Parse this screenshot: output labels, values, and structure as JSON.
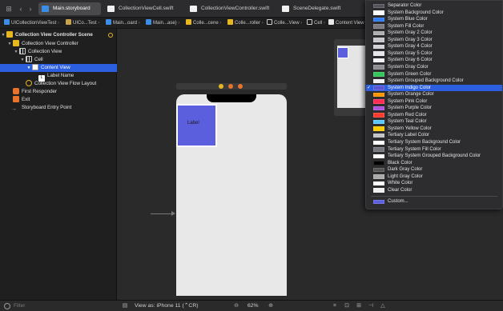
{
  "tabs": [
    {
      "label": "Main.storyboard",
      "kind": "sb",
      "active": true
    },
    {
      "label": "CollectionViewCell.swift",
      "kind": "sw",
      "active": false
    },
    {
      "label": "CollectionViewController.swift",
      "kind": "sw",
      "active": false
    },
    {
      "label": "SceneDelegate.swift",
      "kind": "sw",
      "active": false
    }
  ],
  "breadcrumbs": [
    "UICollectionViewTest",
    "UICo...Test",
    "Main...oard",
    "Main...ase)",
    "Colle...cene",
    "Colle...roller",
    "Colle...View",
    "Cell",
    "Content View"
  ],
  "outline": [
    {
      "label": "Collection View Controller Scene",
      "bold": true
    },
    {
      "label": "Collection View Controller"
    },
    {
      "label": "Collection View"
    },
    {
      "label": "Cell"
    },
    {
      "label": "Content View"
    },
    {
      "label": "Label Name"
    },
    {
      "label": "Collection View Flow Layout"
    },
    {
      "label": "First Responder"
    },
    {
      "label": "Exit"
    },
    {
      "label": "Storyboard Entry Point"
    }
  ],
  "filter_placeholder": "Filter",
  "canvas": {
    "cell_label": "Label"
  },
  "bottom": {
    "view_as": "View as: iPhone 11 (",
    "view_as_key": "⌃C",
    "view_as_tail": "R)",
    "zoom": "62%"
  },
  "menu_items": [
    {
      "label": "Separator Color",
      "color": "#54545a"
    },
    {
      "label": "System Background Color",
      "color": "#ffffff"
    },
    {
      "label": "System Blue Color",
      "color": "#2f7cf6"
    },
    {
      "label": "System Fill Color",
      "color": "#7a7a80"
    },
    {
      "label": "System Gray 2 Color",
      "color": "#aeaeb2"
    },
    {
      "label": "System Gray 3 Color",
      "color": "#c7c7cc"
    },
    {
      "label": "System Gray 4 Color",
      "color": "#d1d1d6"
    },
    {
      "label": "System Gray 5 Color",
      "color": "#e5e5ea"
    },
    {
      "label": "System Gray 6 Color",
      "color": "#f2f2f7"
    },
    {
      "label": "System Gray Color",
      "color": "#8e8e93"
    },
    {
      "label": "System Green Color",
      "color": "#34c759"
    },
    {
      "label": "System Grouped Background Color",
      "color": "#f2f2f7"
    },
    {
      "label": "System Indigo Color",
      "color": "#5856d6",
      "selected": true
    },
    {
      "label": "System Orange Color",
      "color": "#ff9500"
    },
    {
      "label": "System Pink Color",
      "color": "#ff2d55"
    },
    {
      "label": "System Purple Color",
      "color": "#af52de"
    },
    {
      "label": "System Red Color",
      "color": "#ff3b30"
    },
    {
      "label": "System Teal Color",
      "color": "#5ac8fa"
    },
    {
      "label": "System Yellow Color",
      "color": "#ffcc00"
    },
    {
      "label": "Tertiary Label Color",
      "color": "#c4c4c7"
    },
    {
      "label": "Tertiary System Background Color",
      "color": "#ffffff"
    },
    {
      "label": "Tertiary System Fill Color",
      "color": "#76767f"
    },
    {
      "label": "Tertiary System Grouped Background Color",
      "color": "#ffffff"
    },
    {
      "label": "Black Color",
      "color": "#000000"
    },
    {
      "label": "Dark Gray Color",
      "color": "#555555"
    },
    {
      "label": "Light Gray Color",
      "color": "#aaaaaa"
    },
    {
      "label": "White Color",
      "color": "#ffffff"
    },
    {
      "label": "Clear Color",
      "color": "#f0f0f0"
    }
  ],
  "menu_custom": {
    "label": "Custom...",
    "color": "#5b5fde"
  },
  "colors": {
    "accent": "#2b5fe0",
    "cell": "#5b5fde"
  }
}
